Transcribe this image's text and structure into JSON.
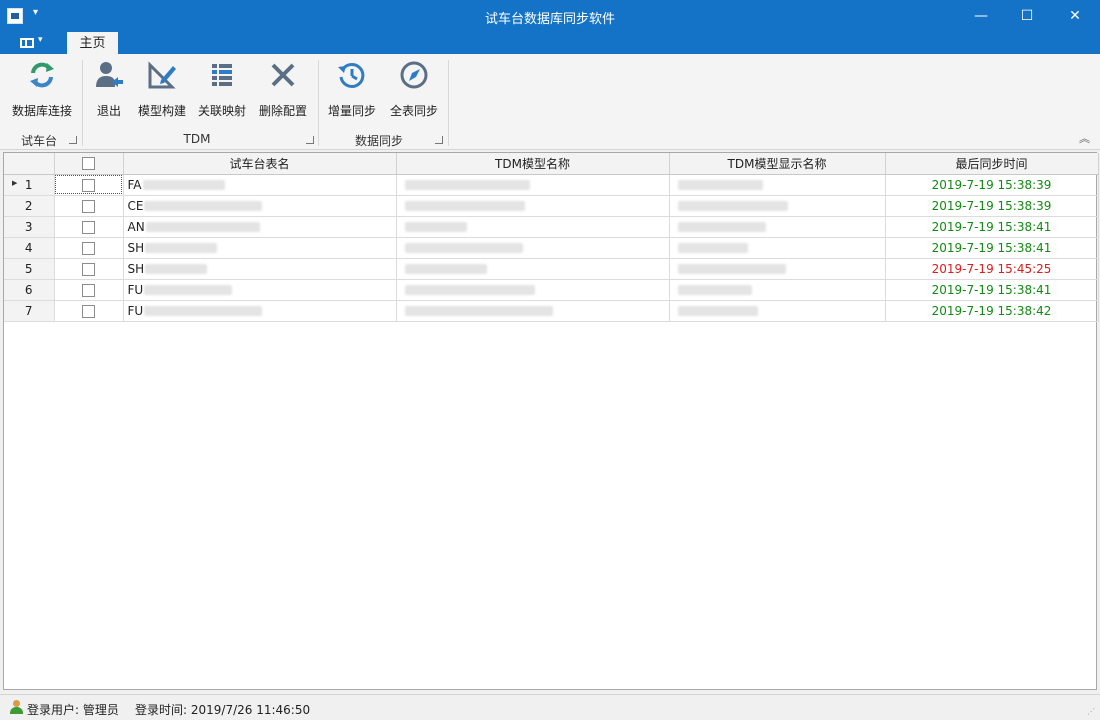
{
  "window": {
    "title": "试车台数据库同步软件",
    "min_glyph": "—",
    "max_glyph": "☐",
    "close_glyph": "✕"
  },
  "ribbon": {
    "tab_home": "主页",
    "groups": [
      {
        "label": "试车台",
        "buttons": [
          {
            "label": "数据库连接",
            "icon": "refresh-sync-icon"
          }
        ]
      },
      {
        "label": "TDM",
        "buttons": [
          {
            "label": "退出",
            "icon": "user-logout-icon"
          },
          {
            "label": "模型构建",
            "icon": "model-build-icon"
          },
          {
            "label": "关联映射",
            "icon": "list-mapping-icon"
          },
          {
            "label": "删除配置",
            "icon": "delete-x-icon"
          }
        ]
      },
      {
        "label": "数据同步",
        "buttons": [
          {
            "label": "增量同步",
            "icon": "history-clock-icon"
          },
          {
            "label": "全表同步",
            "icon": "compass-sync-icon"
          }
        ]
      }
    ]
  },
  "grid": {
    "columns": [
      "试车台表名",
      "TDM模型名称",
      "TDM模型显示名称",
      "最后同步时间"
    ],
    "rows": [
      {
        "num": "1",
        "name": "FA",
        "time": "2019-7-19 15:38:39",
        "status": "ok"
      },
      {
        "num": "2",
        "name": "CE",
        "time": "2019-7-19 15:38:39",
        "status": "ok"
      },
      {
        "num": "3",
        "name": "AN",
        "time": "2019-7-19 15:38:41",
        "status": "ok"
      },
      {
        "num": "4",
        "name": "SH",
        "time": "2019-7-19 15:38:41",
        "status": "ok"
      },
      {
        "num": "5",
        "name": "SH",
        "time": "2019-7-19 15:45:25",
        "status": "warn"
      },
      {
        "num": "6",
        "name": "FU",
        "time": "2019-7-19 15:38:41",
        "status": "ok"
      },
      {
        "num": "7",
        "name": "FU",
        "time": "2019-7-19 15:38:42",
        "status": "ok"
      }
    ],
    "status_colors": {
      "ok": "#128a12",
      "warn": "#e01c1c"
    }
  },
  "status": {
    "user": "登录用户: 管理员",
    "login_time": "登录时间: 2019/7/26 11:46:50"
  }
}
